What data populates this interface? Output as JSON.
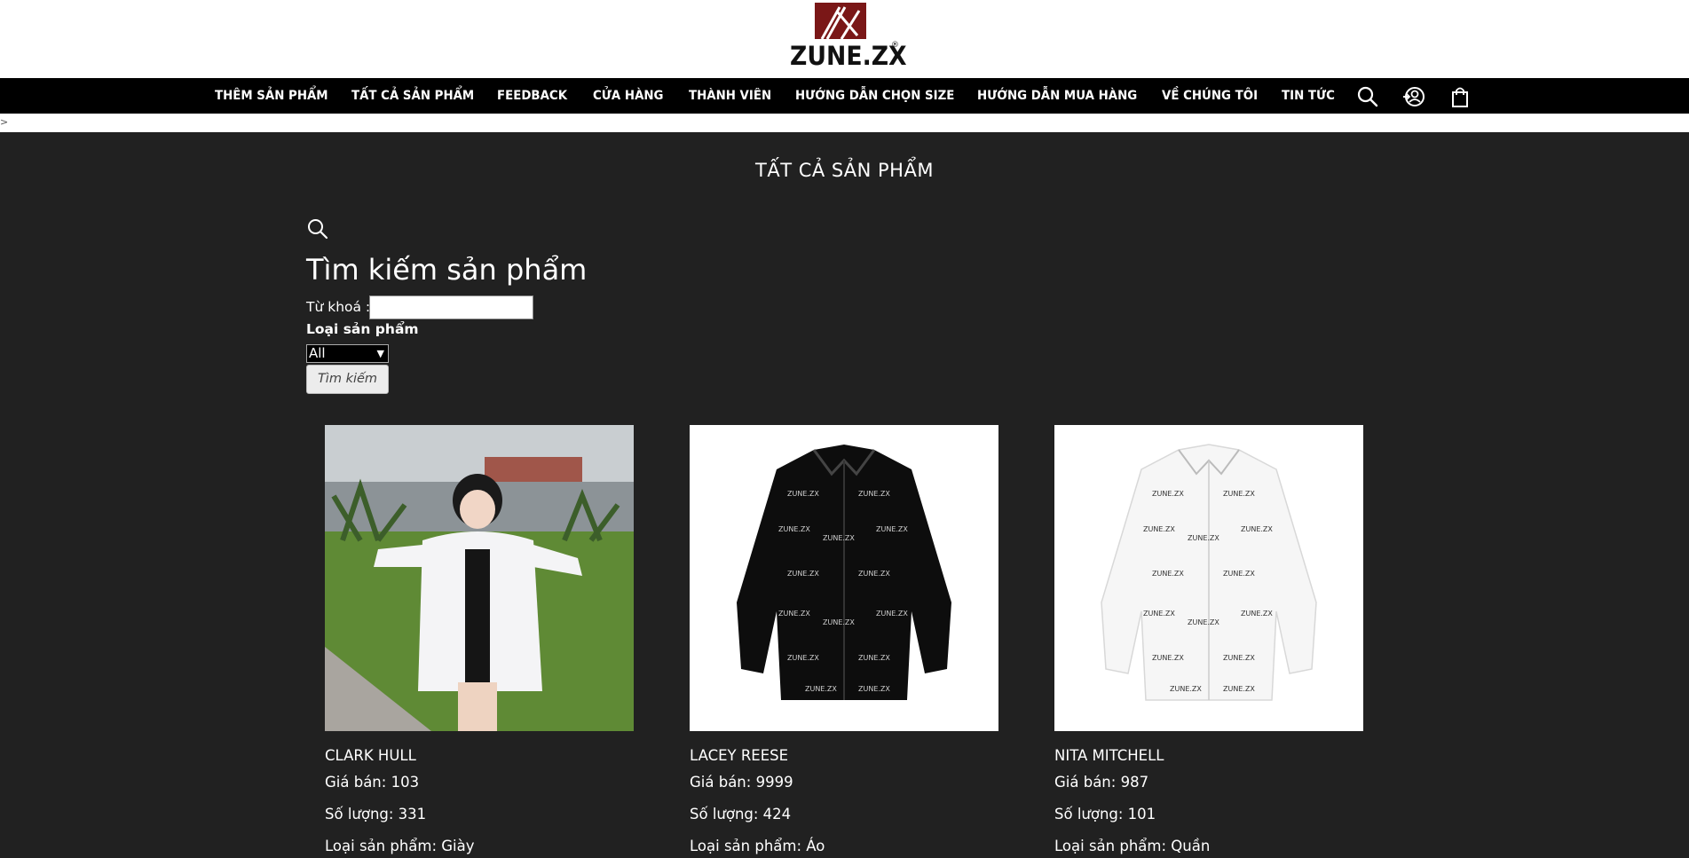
{
  "brand": {
    "name": "ZUNE.ZX",
    "reg_mark": "®"
  },
  "nav": {
    "items": [
      "THÊM SẢN PHẨM",
      "TẤT CẢ SẢN PHẨM",
      "FEEDBACK",
      "CỬA HÀNG",
      "THÀNH VIÊN",
      "HƯỚNG DẪN CHỌN SIZE",
      "HƯỚNG DẪN MUA HÀNG",
      "VỀ CHÚNG TÔI",
      "TIN TỨC"
    ],
    "icons": [
      "search-icon",
      "user-login-icon",
      "shopping-bag-icon"
    ]
  },
  "stray_text": ">",
  "page_title": "TẤT CẢ SẢN PHẨM",
  "search": {
    "icon": "search-icon",
    "heading": "Tìm kiếm sản phẩm",
    "keyword_label": "Từ khoá :",
    "keyword_value": "",
    "type_label": "Loại sản phẩm",
    "type_selected": "All",
    "button_label": "Tìm kiếm"
  },
  "colors": {
    "background": "#212121",
    "navbar": "#000000",
    "logo": "#7a1717"
  },
  "products": [
    {
      "name": "CLARK HULL",
      "price": "Giá bán: 103",
      "quantity": "Số lượng: 331",
      "type": "Loại sản phẩm: Giày",
      "image": "photo of girl in white oversized jacket"
    },
    {
      "name": "LACEY REESE",
      "price": "Giá bán: 9999",
      "quantity": "Số lượng: 424",
      "type": "Loại sản phẩm: Áo",
      "image": "black long-sleeve shirt with logo print"
    },
    {
      "name": "NITA MITCHELL",
      "price": "Giá bán: 987",
      "quantity": "Số lượng: 101",
      "type": "Loại sản phẩm: Quần",
      "image": "white long-sleeve shirt with logo print"
    }
  ]
}
